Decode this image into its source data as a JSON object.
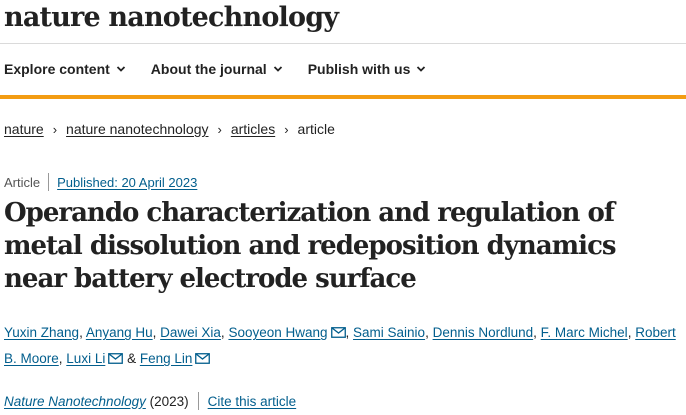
{
  "header": {
    "brand": "nature nanotechnology"
  },
  "nav": {
    "items": [
      {
        "label": "Explore content"
      },
      {
        "label": "About the journal"
      },
      {
        "label": "Publish with us"
      }
    ]
  },
  "breadcrumb": {
    "items": [
      {
        "label": "nature"
      },
      {
        "label": "nature nanotechnology"
      },
      {
        "label": "articles"
      },
      {
        "label": "article"
      }
    ]
  },
  "article": {
    "type": "Article",
    "published": "Published: 20 April 2023",
    "title": "Operando characterization and regulation of metal dissolution and redeposition dynamics near battery electrode surface",
    "authors": [
      {
        "name": "Yuxin Zhang"
      },
      {
        "name": "Anyang Hu"
      },
      {
        "name": "Dawei Xia"
      },
      {
        "name": "Sooyeon Hwang"
      },
      {
        "name": "Sami Sainio"
      },
      {
        "name": "Dennis Nordlund"
      },
      {
        "name": "F. Marc Michel"
      },
      {
        "name": "Robert B. Moore"
      },
      {
        "name": "Luxi Li"
      },
      {
        "name": "Feng Lin"
      }
    ],
    "journal": "Nature Nanotechnology",
    "year": "(2023)",
    "cite_label": "Cite this article"
  },
  "icons": {
    "nav_chevron": "chevron-down-icon",
    "breadcrumb_separator": "chevron-right-icon",
    "author_email": "mail-icon"
  },
  "colors": {
    "accent": "#f39c12",
    "link": "#025e8d"
  }
}
